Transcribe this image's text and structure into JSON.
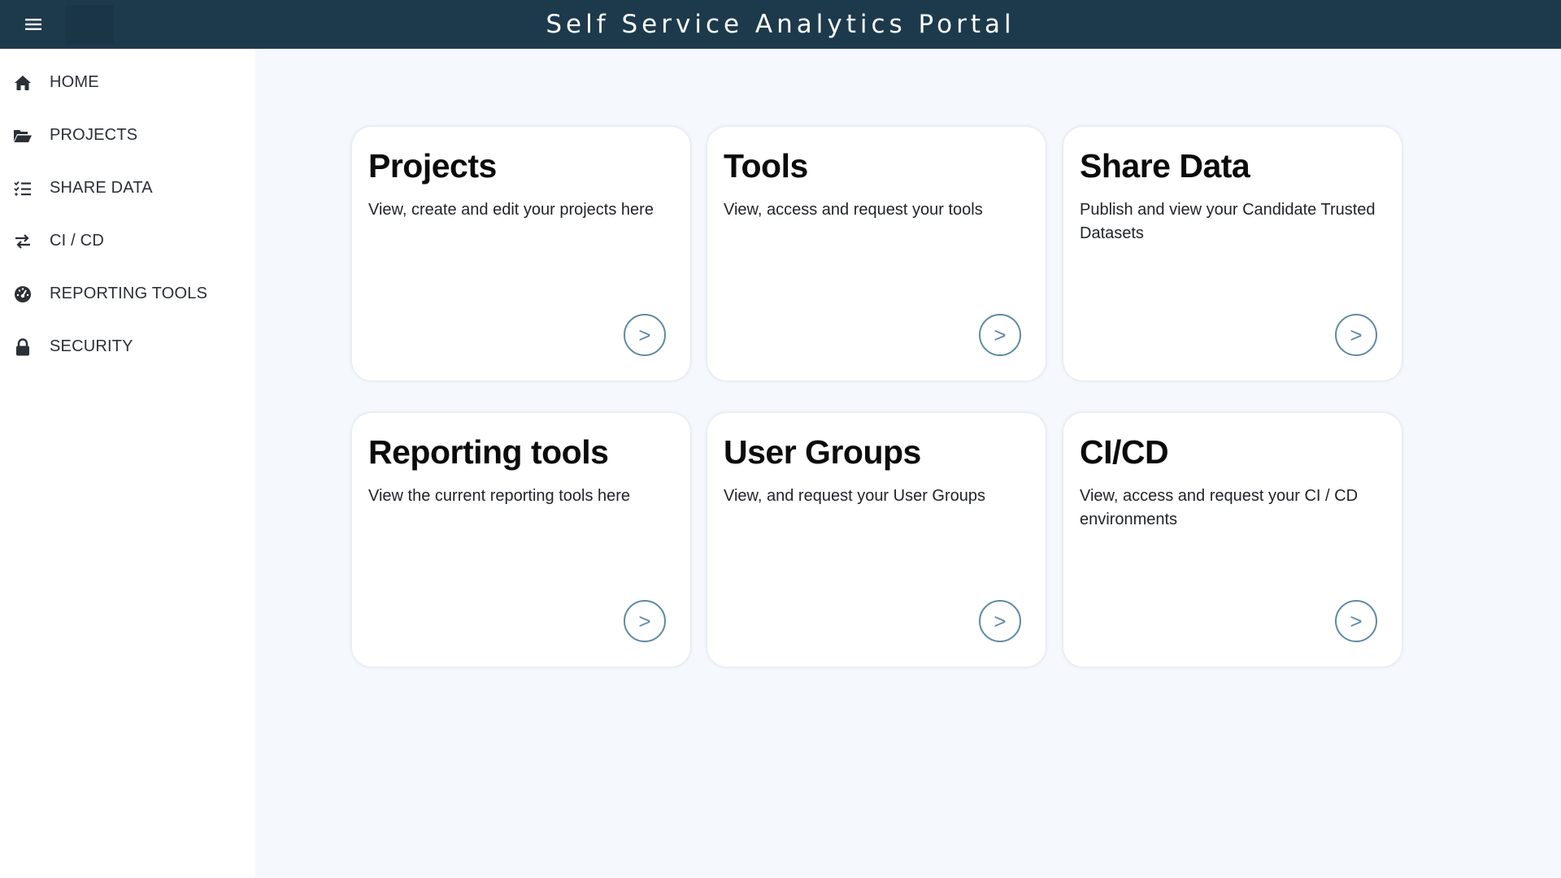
{
  "header": {
    "title": "Self Service Analytics Portal"
  },
  "sidebar": {
    "items": [
      {
        "label": "HOME",
        "icon": "home-icon"
      },
      {
        "label": "PROJECTS",
        "icon": "folder-open-icon"
      },
      {
        "label": "SHARE DATA",
        "icon": "checklist-icon"
      },
      {
        "label": "CI / CD",
        "icon": "swap-arrows-icon"
      },
      {
        "label": "REPORTING TOOLS",
        "icon": "gauge-icon"
      },
      {
        "label": "SECURITY",
        "icon": "lock-icon"
      }
    ]
  },
  "cards": [
    {
      "title": "Projects",
      "description": "View, create and edit your projects here",
      "arrow": ">"
    },
    {
      "title": "Tools",
      "description": "View, access and request your tools",
      "arrow": ">"
    },
    {
      "title": "Share Data",
      "description": "Publish and view your Candidate Trusted Datasets",
      "arrow": ">"
    },
    {
      "title": "Reporting tools",
      "description": "View the current reporting tools here",
      "arrow": ">"
    },
    {
      "title": "User Groups",
      "description": "View, and request your User Groups",
      "arrow": ">"
    },
    {
      "title": "CI/CD",
      "description": "View, access and request your CI / CD environments",
      "arrow": ">"
    }
  ],
  "colors": {
    "header_bg": "#1d3a4d",
    "page_bg": "#f5f8fd",
    "arrow_accent": "#5f8aa3"
  }
}
